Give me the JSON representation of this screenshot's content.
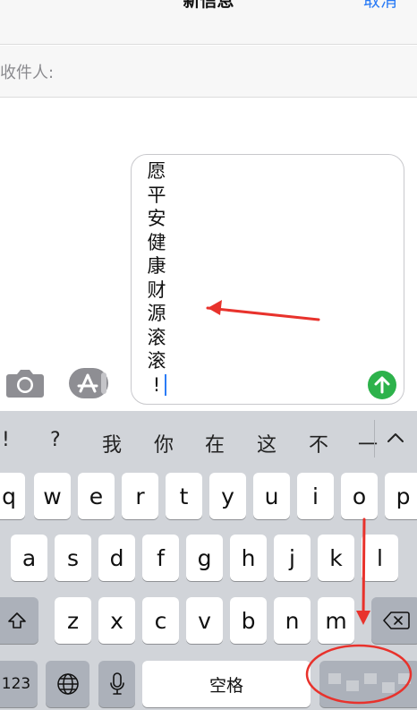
{
  "nav": {
    "title": "新信息",
    "cancel_label": "取消"
  },
  "recipient": {
    "label": "收件人:"
  },
  "message": {
    "chars": [
      "愿",
      "平",
      "安",
      "健",
      "康",
      "财",
      "源",
      "滚",
      "滚",
      "!"
    ]
  },
  "keyboard": {
    "candidates": [
      "!",
      "?",
      "我",
      "你",
      "在",
      "这",
      "不",
      "一"
    ],
    "row1": [
      "q",
      "w",
      "e",
      "r",
      "t",
      "y",
      "u",
      "i",
      "o",
      "p"
    ],
    "row2": [
      "a",
      "s",
      "d",
      "f",
      "g",
      "h",
      "j",
      "k",
      "l"
    ],
    "row3": [
      "z",
      "x",
      "c",
      "v",
      "b",
      "n",
      "m"
    ],
    "numbers_label": "123",
    "space_label": "空格"
  },
  "colors": {
    "accent": "#2b7cf6",
    "send": "#2db24b",
    "annotation": "#e8322c"
  }
}
